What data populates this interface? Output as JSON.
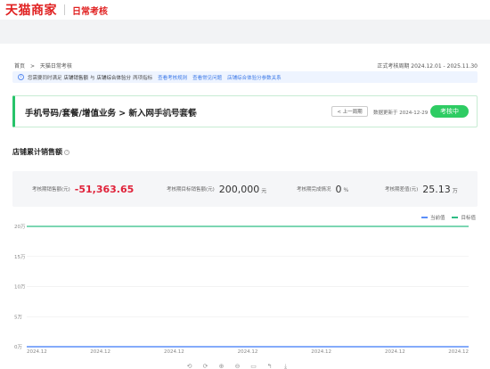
{
  "header": {
    "logo": "天猫商家",
    "section": "日常考核"
  },
  "breadcrumb": {
    "home": "首页",
    "sep": ">",
    "current": "天猫日常考核"
  },
  "period": {
    "label": "正式考核周期 2024.12.01 - 2025.11.30"
  },
  "notice": {
    "text_prefix": "您需要同时满足",
    "item1": "店铺销售额",
    "joiner": "与",
    "item2": "店铺综合体验分",
    "text_suffix": "两项指标",
    "link1": "查看考核规则",
    "link2": "查看常见问题",
    "link3": "店铺综合体验分参数关系"
  },
  "business": {
    "name": "手机号码/套餐/增值业务 > 新入网手机号套餐",
    "meta": "考核主营类目",
    "prev_button": "< 上一周期",
    "updated": "数据更新于 2024-12-29",
    "status": "考核中"
  },
  "section": {
    "title": "店铺累计销售额"
  },
  "stats": [
    {
      "label": "考核期销售额(元)",
      "value": "-51,363.65",
      "unit": ""
    },
    {
      "label": "考核期目标销售额(元)",
      "value": "200,000",
      "unit": "元"
    },
    {
      "label": "考核期完成情况",
      "value": "0",
      "unit": "%"
    },
    {
      "label": "考核期差值(元)",
      "value": "25.13",
      "unit": "万"
    }
  ],
  "legend": {
    "current": "当前值",
    "target": "目标值"
  },
  "colors": {
    "current": "#5b8ff9",
    "target": "#2ebd85",
    "status": "#2ecc63",
    "negative": "#e0223a"
  },
  "chart_data": {
    "type": "line",
    "y_ticks": [
      "20万",
      "15万",
      "10万",
      "5万",
      "0万"
    ],
    "ylim": [
      0,
      200000
    ],
    "categories": [
      "2024.12",
      "2024.12",
      "2024.12",
      "2024.12",
      "2024.12",
      "2024.12",
      "2024.12"
    ],
    "series": [
      {
        "name": "当前值",
        "values": [
          0,
          0,
          0,
          0,
          0,
          0,
          0
        ]
      },
      {
        "name": "目标值",
        "values": [
          200000,
          200000,
          200000,
          200000,
          200000,
          200000,
          200000
        ]
      }
    ]
  },
  "toolbar": {
    "icons": [
      "zoom-in-icon",
      "zoom-out-icon",
      "search-icon",
      "search-minus-icon",
      "data-view-icon",
      "restore-icon",
      "download-icon"
    ],
    "glyphs": [
      "⟲",
      "⟳",
      "⊕",
      "⊖",
      "▭",
      "↰",
      "⤓"
    ]
  }
}
